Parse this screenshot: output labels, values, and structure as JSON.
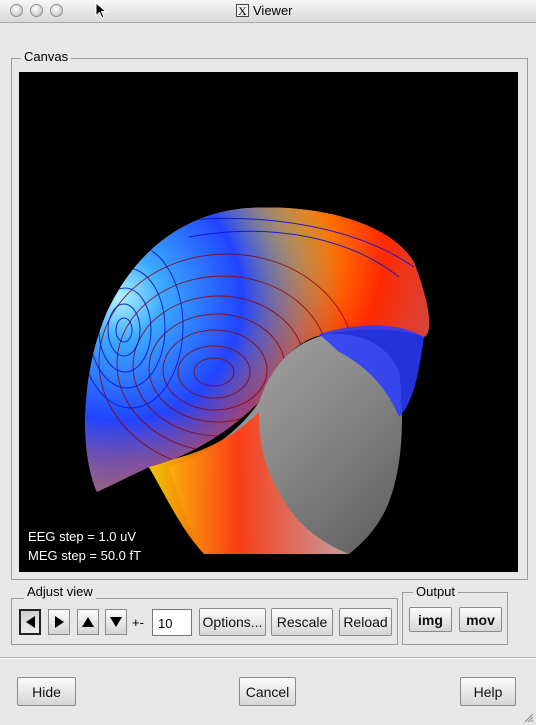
{
  "window": {
    "title": "Viewer"
  },
  "canvas_panel": {
    "label": "Canvas",
    "eeg_step": "EEG step =     1.0 uV",
    "meg_step": "MEG step =    50.0 fT"
  },
  "adjust_view": {
    "label": "Adjust view",
    "step_label": "+-",
    "step_value": "10",
    "options_label": "Options...",
    "rescale_label": "Rescale",
    "reload_label": "Reload"
  },
  "output": {
    "label": "Output",
    "img_label": "img",
    "mov_label": "mov"
  },
  "footer": {
    "hide_label": "Hide",
    "cancel_label": "Cancel",
    "help_label": "Help"
  },
  "colors": {
    "positive": "#ff2a00",
    "peak": "#ffe600",
    "negative": "#2244ff",
    "head": "#8a8a8a",
    "background": "#000000"
  }
}
